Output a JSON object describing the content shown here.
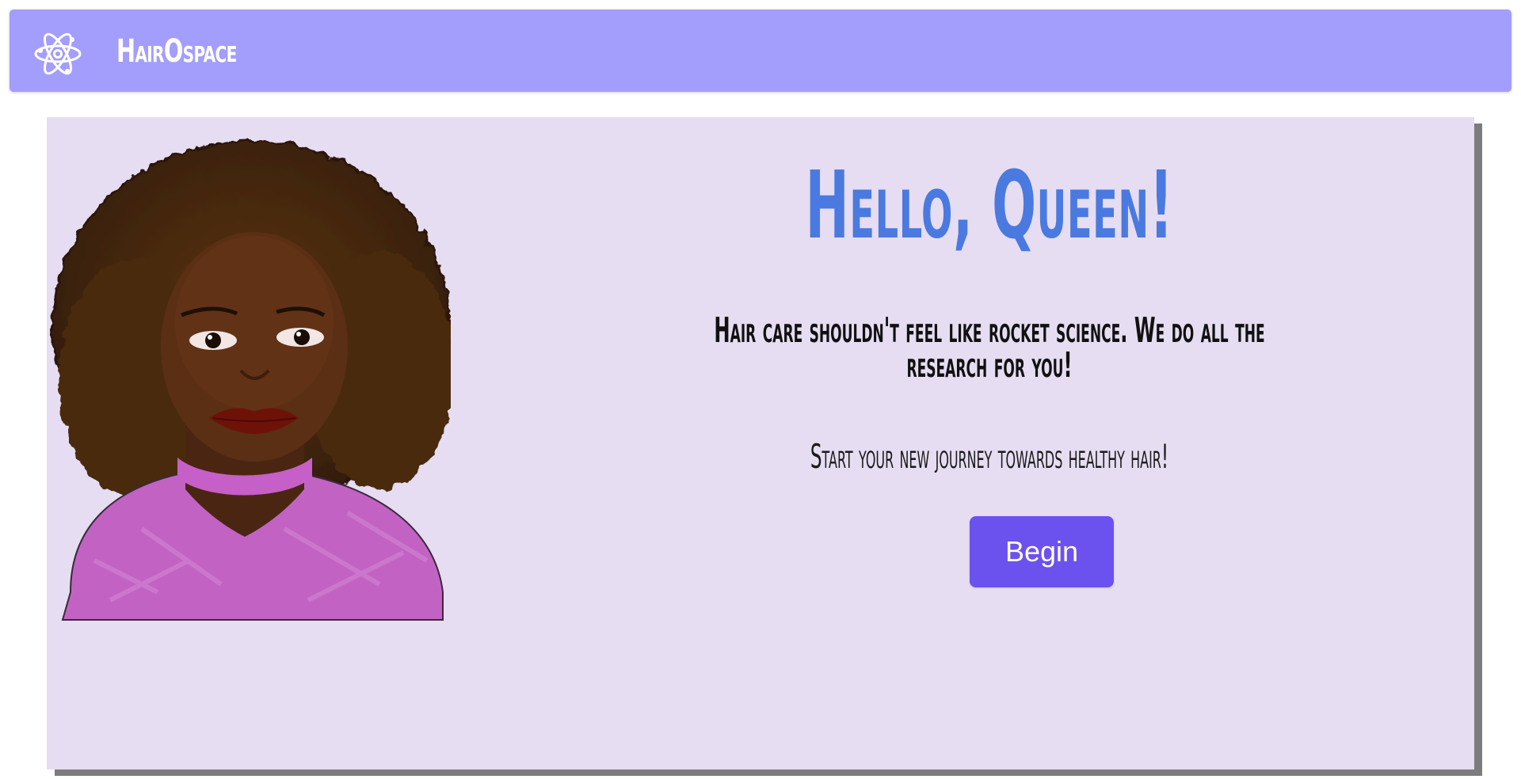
{
  "navbar": {
    "logo_icon": "atom-icon",
    "brand": "HairOspace",
    "color": "#a39dfc"
  },
  "hero": {
    "portrait_icon": "woman-portrait-illustration",
    "greeting": "Hello, Queen!",
    "tagline": "Hair care shouldn't feel like rocket science. We do all the research for you!",
    "subline": "Start your new journey towards healthy hair!",
    "begin_label": "Begin",
    "card_color": "#e6ddf2",
    "greeting_color": "#4a7ae0",
    "button_color": "#6b52ee"
  }
}
